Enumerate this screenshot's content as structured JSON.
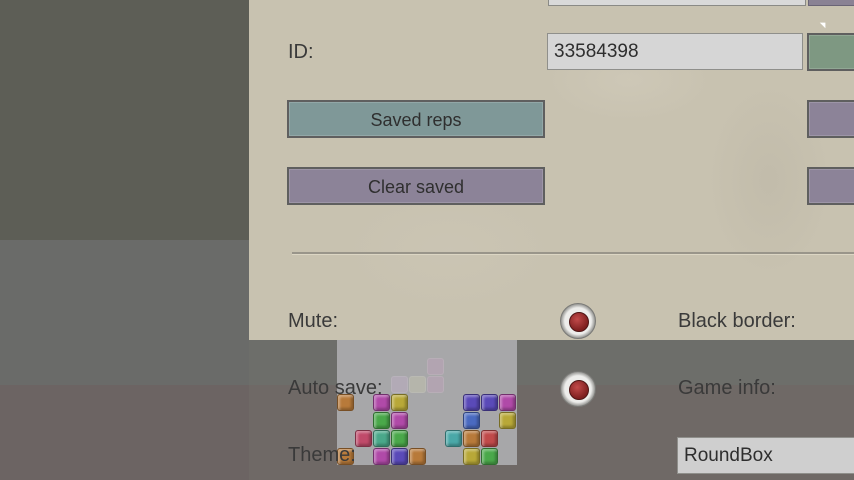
{
  "settings": {
    "id_label": "ID:",
    "id_value": "33584398",
    "saved_reps_label": "Saved reps",
    "clear_saved_label": "Clear saved",
    "mute_label": "Mute:",
    "black_border_label": "Black border:",
    "auto_save_label": "Auto save:",
    "game_info_label": "Game info:",
    "theme_label": "Theme:",
    "theme_value": "RoundBox",
    "mute_on": true,
    "auto_save_on": true
  },
  "colors": {
    "button_teal": "#7f9898",
    "button_purple": "#8c8398",
    "toggle_dot": "#9b3030",
    "panel": "#c8c2b0"
  },
  "icons": {
    "toggle": "radio-toggle-icon",
    "cursor": "mouse-cursor-icon"
  }
}
